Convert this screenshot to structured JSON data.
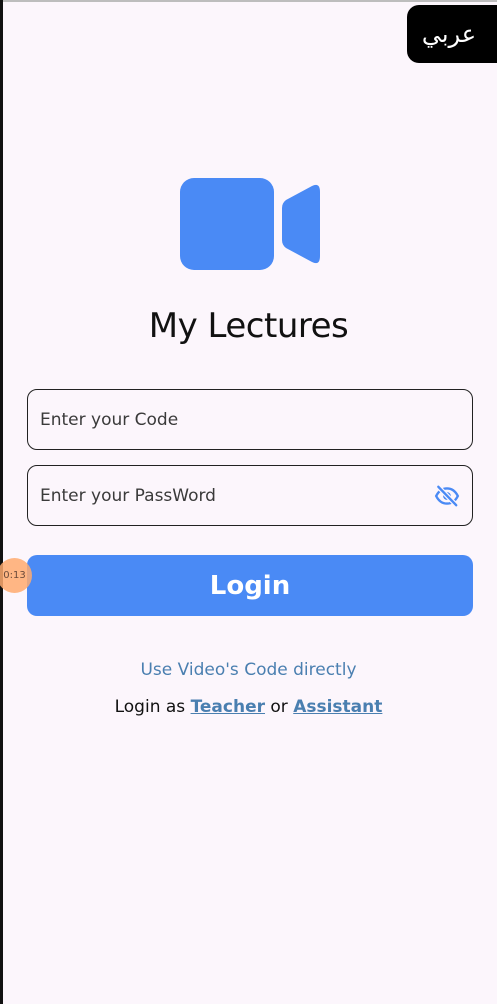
{
  "language_toggle": {
    "label": "عربي"
  },
  "app": {
    "title": "My Lectures"
  },
  "login_form": {
    "code_placeholder": "Enter your Code",
    "password_placeholder": "Enter your PassWord",
    "submit_label": "Login"
  },
  "links": {
    "video_code": "Use Video's Code directly",
    "login_as_prefix": "Login as",
    "teacher": "Teacher",
    "or": "or",
    "assistant": "Assistant"
  },
  "touch_indicator": {
    "label": "0:13"
  },
  "icons": {
    "logo": "video-camera-icon",
    "password_toggle": "eye-off-icon"
  },
  "colors": {
    "accent": "#4a8af5",
    "link": "#4a7fb0",
    "background": "#fcf6fc"
  }
}
